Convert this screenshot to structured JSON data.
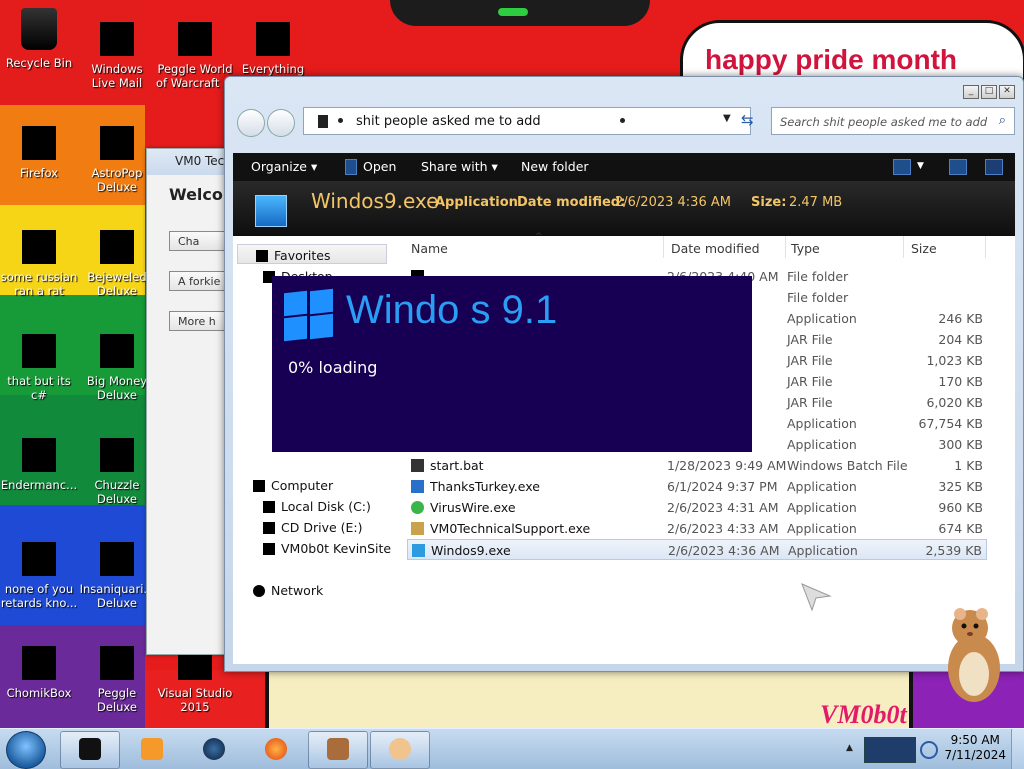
{
  "wallpaper": {
    "banner": "happy pride month",
    "watermark": "VM0b0t"
  },
  "desktop_icons": [
    {
      "label": "Recycle Bin",
      "icon": "recycle-bin-icon"
    },
    {
      "label": "Windows Live Mail",
      "icon": "mail-icon"
    },
    {
      "label": "Peggle World of Warcraft ...",
      "icon": "peggle-icon"
    },
    {
      "label": "Everything",
      "icon": "search-tool-icon"
    },
    {
      "label": "Firefox",
      "icon": "firefox-icon"
    },
    {
      "label": "AstroPop Deluxe",
      "icon": "game-icon"
    },
    {
      "label": "some russian ran a rat",
      "icon": "app-icon"
    },
    {
      "label": "Bejeweled Deluxe",
      "icon": "gem-icon"
    },
    {
      "label": "that but its c#",
      "icon": "app-icon"
    },
    {
      "label": "Big Money Deluxe",
      "icon": "money-icon"
    },
    {
      "label": "Endermanc...",
      "icon": "app-icon"
    },
    {
      "label": "Chuzzle Deluxe",
      "icon": "game-icon"
    },
    {
      "label": "none of you retards kno...",
      "icon": "app-icon"
    },
    {
      "label": "Insaniquari... Deluxe",
      "icon": "game-icon"
    },
    {
      "label": "ChomikBox",
      "icon": "hamster-icon"
    },
    {
      "label": "Peggle Deluxe",
      "icon": "peggle-icon"
    },
    {
      "label": "Visual Studio 2015",
      "icon": "visual-studio-icon"
    }
  ],
  "back_window": {
    "title": "VM0 Tech",
    "heading": "Welcom",
    "buttons": [
      "Cha",
      "A forkie is",
      "More h"
    ]
  },
  "explorer": {
    "address": "shit people asked me to add",
    "search_placeholder": "Search shit people asked me to add",
    "window_controls": [
      "_",
      "□",
      "✕"
    ],
    "toolbar": {
      "organize": "Organize",
      "open": "Open",
      "share_with": "Share with",
      "new_folder": "New folder"
    },
    "details": {
      "name": "Windos9.exe",
      "type": "Application",
      "date_modified_label": "Date modified:",
      "date_modified": "2/6/2023 4:36 AM",
      "size_label": "Size:",
      "size": "2.47 MB"
    },
    "nav": {
      "favorites": "Favorites",
      "desktop": "Desktop",
      "computer": "Computer",
      "local_disk": "Local Disk (C:)",
      "cd_drive": "CD Drive (E:)",
      "site": "VM0b0t KevinSite",
      "network": "Network"
    },
    "columns": {
      "name": "Name",
      "date": "Date modified",
      "type": "Type",
      "size": "Size"
    },
    "files": [
      {
        "name": "",
        "date": "2/6/2023 4:40 AM",
        "type": "File folder",
        "size": ""
      },
      {
        "name": "",
        "date": "AM",
        "type": "File folder",
        "size": ""
      },
      {
        "name": "",
        "date": "AM",
        "type": "Application",
        "size": "246 KB"
      },
      {
        "name": "",
        "date": "AM",
        "type": "JAR File",
        "size": "204 KB"
      },
      {
        "name": "",
        "date": "AM",
        "type": "JAR File",
        "size": "1,023 KB"
      },
      {
        "name": "",
        "date": "AM",
        "type": "JAR File",
        "size": "170 KB"
      },
      {
        "name": "",
        "date": "AM",
        "type": "JAR File",
        "size": "6,020 KB"
      },
      {
        "name": "",
        "date": "AM",
        "type": "Application",
        "size": "67,754 KB"
      },
      {
        "name": "",
        "date": "AM",
        "type": "Application",
        "size": "300 KB"
      },
      {
        "name": "start.bat",
        "date": "1/28/2023 9:49 AM",
        "type": "Windows Batch File",
        "size": "1 KB"
      },
      {
        "name": "ThanksTurkey.exe",
        "date": "6/1/2024 9:37 PM",
        "type": "Application",
        "size": "325 KB"
      },
      {
        "name": "VirusWire.exe",
        "date": "2/6/2023 4:31 AM",
        "type": "Application",
        "size": "960 KB"
      },
      {
        "name": "VM0TechnicalSupport.exe",
        "date": "2/6/2023 4:33 AM",
        "type": "Application",
        "size": "674 KB"
      },
      {
        "name": "Windos9.exe",
        "date": "2/6/2023 4:36 AM",
        "type": "Application",
        "size": "2,539 KB"
      }
    ]
  },
  "splash": {
    "title": "Windo   s 9.1",
    "status": "0% loading",
    "accent": "#2a9df4",
    "background": "#170053"
  },
  "taskbar": {
    "apps": [
      "explorer-app",
      "media-player-app",
      "globe-app",
      "firefox-app",
      "chomikbox-app",
      "support-app"
    ],
    "time": "9:50 AM",
    "date": "7/11/2024"
  }
}
